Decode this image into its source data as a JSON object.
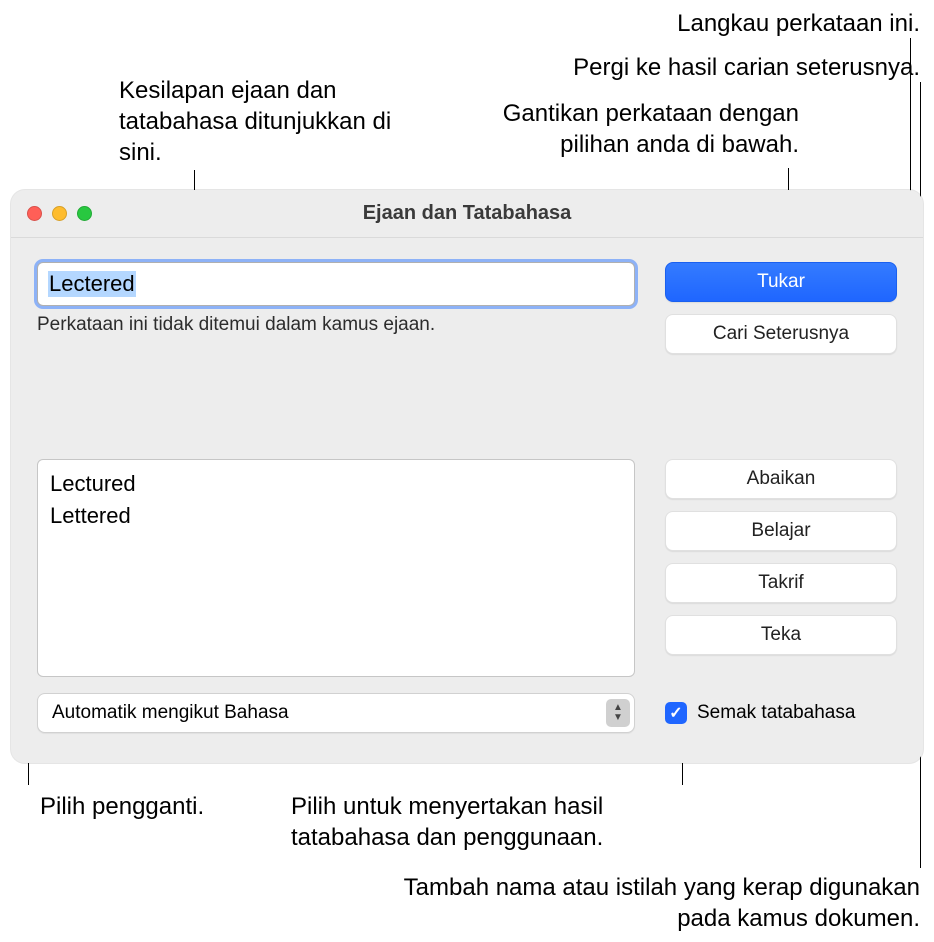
{
  "callouts": {
    "skip": "Langkau perkataan ini.",
    "next_result": "Pergi ke hasil carian seterusnya.",
    "errors_shown": "Kesilapan ejaan dan tatabahasa ditunjukkan di sini.",
    "replace_with": "Gantikan perkataan dengan pilihan anda di bawah.",
    "choose_replacement": "Pilih pengganti.",
    "include_grammar": "Pilih untuk menyertakan hasil tatabahasa dan penggunaan.",
    "add_dictionary": "Tambah nama atau istilah yang kerap digunakan pada kamus dokumen."
  },
  "window": {
    "title": "Ejaan dan Tatabahasa",
    "input_value": "Lectered",
    "status": "Perkataan ini tidak ditemui dalam kamus ejaan.",
    "buttons": {
      "change": "Tukar",
      "find_next": "Cari Seterusnya",
      "ignore": "Abaikan",
      "learn": "Belajar",
      "define": "Takrif",
      "guess": "Teka"
    },
    "suggestions": [
      "Lectured",
      "Lettered"
    ],
    "language_select": "Automatik mengikut Bahasa",
    "check_grammar_label": "Semak tatabahasa"
  }
}
